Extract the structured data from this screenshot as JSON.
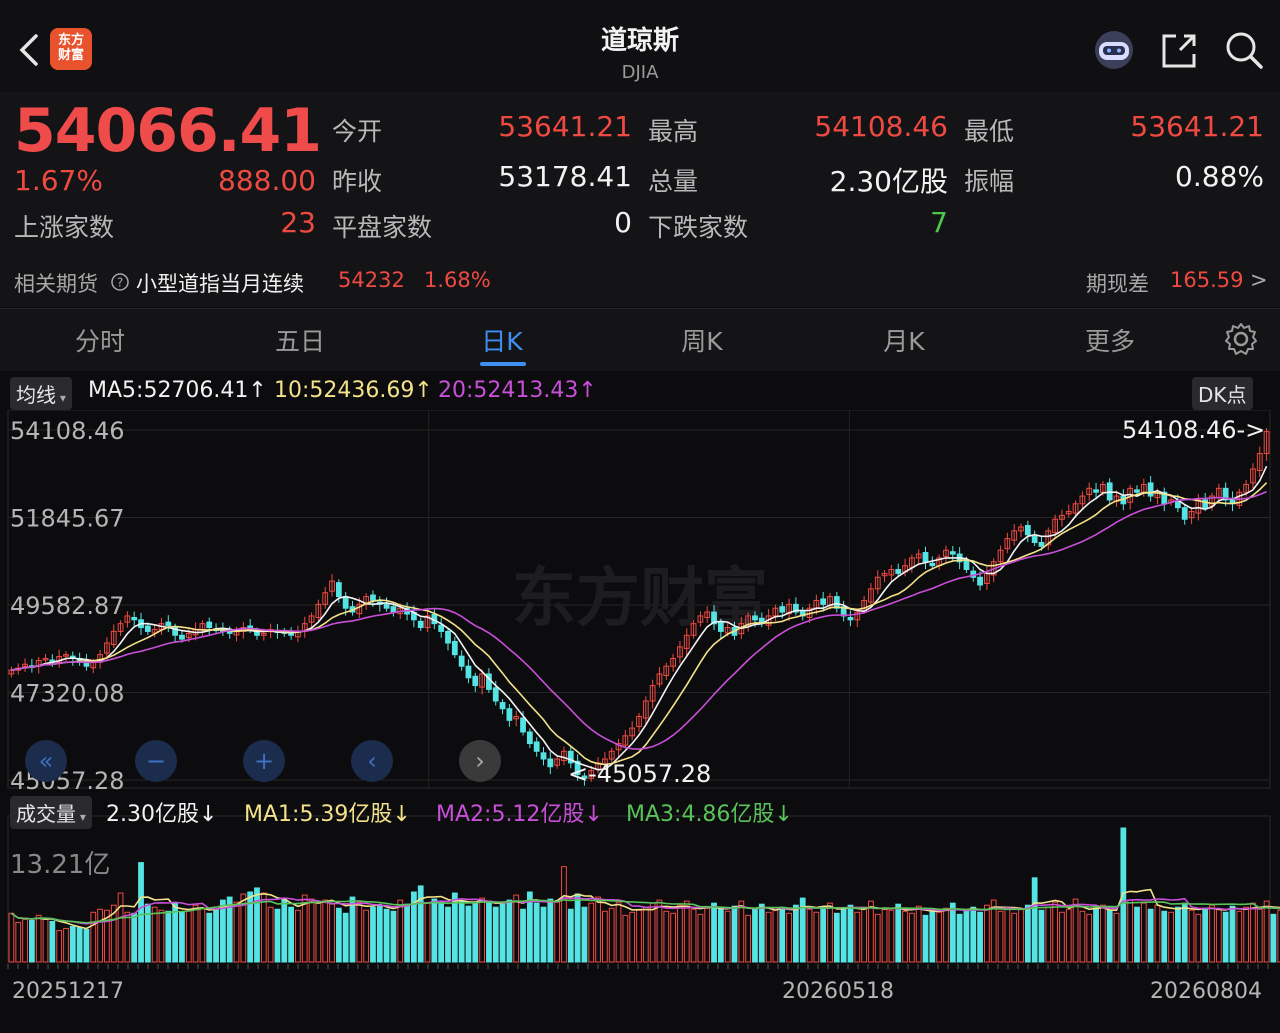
{
  "header": {
    "back_icon": "chevron-left-icon",
    "logo_text_1": "东方",
    "logo_text_2": "财富",
    "title": "道琼斯",
    "subtitle": "DJIA",
    "robot_icon": "robot-assistant-icon",
    "share_icon": "share-icon",
    "search_icon": "search-icon"
  },
  "quote": {
    "price": "54066.41",
    "change_pct": "1.67%",
    "change_abs": "888.00",
    "rows": [
      {
        "l1": "今开",
        "v1": "53641.21",
        "c1": "red",
        "l2": "最高",
        "v2": "54108.46",
        "c2": "red",
        "l3": "最低",
        "v3": "53641.21",
        "c3": "red"
      },
      {
        "l1": "昨收",
        "v1": "53178.41",
        "c1": "wht",
        "l2": "总量",
        "v2": "2.30亿股",
        "c2": "wht",
        "l3": "振幅",
        "v3": "0.88%",
        "c3": "wht"
      }
    ],
    "up_label": "上涨家数",
    "up_value": "23",
    "flat_label": "平盘家数",
    "flat_value": "0",
    "down_label": "下跌家数",
    "down_value": "7"
  },
  "futures": {
    "label": "相关期货",
    "help_icon": "help-circle-icon",
    "name": "小型道指当月连续",
    "price": "54232",
    "pct": "1.68%",
    "basis_label": "期现差",
    "basis_value": "165.59",
    "arrow": ">"
  },
  "tabs": [
    "分时",
    "五日",
    "日K",
    "周K",
    "月K",
    "更多"
  ],
  "active_tab": "日K",
  "settings_icon": "gear-icon",
  "ma": {
    "label": "均线",
    "ma5": "MA5:52706.41",
    "ma10": "10:52436.69",
    "ma20": "20:52413.43",
    "dk_label": "DK点",
    "colors": {
      "ma5": "#f2f2f2",
      "ma10": "#f3e28a",
      "ma20": "#c84fd8"
    }
  },
  "volume": {
    "label": "成交量",
    "value": "2.30亿股",
    "ma1": "MA1:5.39亿股",
    "ma2": "MA2:5.12亿股",
    "ma3": "MA3:4.86亿股",
    "axis_top": "13.21亿",
    "colors": {
      "ma1": "#f3e28a",
      "ma2": "#c84fd8",
      "ma3": "#58c35a"
    }
  },
  "watermark": "东方财富",
  "controls": [
    "«",
    "−",
    "+",
    "‹",
    "›"
  ],
  "chart_data": {
    "type": "candlestick",
    "y_ticks": [
      "54108.46",
      "51845.67",
      "49582.87",
      "47320.08",
      "45057.28"
    ],
    "ylim": [
      45057.28,
      54108.46
    ],
    "x_ticks": [
      "20251217",
      "20260518",
      "20260804"
    ],
    "annotations": {
      "high": "54108.46->",
      "low": "<-45057.28"
    },
    "colors": {
      "up": "#ef4a42",
      "down": "#55e3e3"
    },
    "close_series": [
      47900,
      47950,
      48050,
      48000,
      48150,
      48200,
      48100,
      48250,
      48300,
      48200,
      48100,
      48000,
      48100,
      48300,
      48600,
      48900,
      49100,
      49300,
      49200,
      49000,
      48900,
      48950,
      49100,
      49050,
      48800,
      48700,
      48850,
      48950,
      49100,
      49000,
      48950,
      48900,
      48850,
      48900,
      49000,
      48950,
      48800,
      48850,
      48950,
      48900,
      48850,
      48800,
      48900,
      49100,
      49300,
      49600,
      49900,
      50200,
      49800,
      49500,
      49400,
      49600,
      49800,
      49700,
      49600,
      49500,
      49400,
      49500,
      49350,
      49200,
      49000,
      49300,
      49100,
      48900,
      48600,
      48300,
      48000,
      47700,
      47500,
      47800,
      47400,
      47100,
      46900,
      46600,
      46700,
      46300,
      46000,
      45800,
      45600,
      45400,
      45600,
      45800,
      45500,
      45200,
      45100,
      45300,
      45500,
      45600,
      45800,
      46000,
      46200,
      46400,
      46700,
      47100,
      47500,
      47800,
      48000,
      48200,
      48500,
      48800,
      49100,
      49300,
      49400,
      49100,
      48900,
      49000,
      48800,
      49100,
      49300,
      49200,
      49100,
      49300,
      49500,
      49400,
      49600,
      49400,
      49300,
      49500,
      49700,
      49600,
      49800,
      49500,
      49300,
      49200,
      49400,
      49700,
      50000,
      50300,
      50400,
      50500,
      50400,
      50600,
      50800,
      50900,
      50700,
      50600,
      50800,
      51000,
      50900,
      50700,
      50500,
      50300,
      50100,
      50400,
      50700,
      51000,
      51300,
      51500,
      51600,
      51400,
      51200,
      51100,
      51500,
      51800,
      51900,
      52000,
      52200,
      52400,
      52600,
      52500,
      52700,
      52300,
      52400,
      52200,
      52600,
      52500,
      52700,
      52400,
      52500,
      52200,
      52300,
      52100,
      51800,
      52000,
      52300,
      52100,
      52400,
      52600,
      52300,
      52200,
      52500,
      52700,
      53100,
      53500,
      54066.41
    ],
    "volume_series": [
      4.8,
      3.9,
      4.2,
      4.1,
      4.6,
      4.3,
      4.0,
      3.1,
      3.3,
      3.5,
      3.4,
      3.2,
      4.9,
      5.2,
      5.1,
      5.6,
      6.8,
      4.9,
      4.8,
      9.8,
      5.7,
      5.4,
      5.1,
      5.0,
      5.8,
      4.9,
      5.1,
      5.6,
      5.3,
      4.8,
      5.2,
      6.1,
      6.4,
      5.9,
      6.7,
      6.9,
      7.3,
      6.8,
      5.4,
      5.2,
      6.3,
      5.4,
      5.1,
      6.6,
      6.2,
      5.8,
      6.1,
      5.7,
      5.3,
      4.8,
      6.4,
      5.9,
      5.1,
      5.4,
      5.6,
      5.2,
      5.0,
      6.1,
      5.7,
      6.9,
      7.5,
      5.8,
      6.2,
      5.9,
      5.4,
      6.8,
      6.0,
      5.5,
      5.8,
      6.3,
      6.0,
      5.4,
      5.7,
      6.1,
      6.6,
      5.2,
      6.9,
      5.8,
      5.4,
      6.2,
      5.9,
      9.4,
      5.2,
      6.7,
      5.4,
      5.8,
      6.4,
      5.0,
      5.3,
      5.9,
      4.6,
      4.9,
      5.1,
      5.4,
      5.8,
      6.1,
      5.0,
      4.8,
      5.6,
      6.0,
      5.2,
      4.7,
      5.3,
      5.8,
      5.4,
      5.0,
      5.5,
      6.0,
      4.6,
      5.3,
      5.7,
      4.9,
      5.1,
      5.4,
      4.8,
      5.6,
      6.3,
      5.2,
      4.9,
      5.4,
      5.8,
      4.8,
      5.3,
      5.6,
      4.9,
      5.4,
      6.0,
      4.7,
      5.2,
      5.1,
      5.7,
      5.0,
      4.8,
      5.5,
      4.6,
      5.2,
      4.9,
      5.3,
      5.8,
      4.7,
      5.1,
      5.4,
      4.9,
      5.6,
      6.1,
      5.0,
      5.3,
      4.8,
      5.2,
      5.6,
      8.3,
      5.1,
      5.4,
      5.9,
      4.9,
      5.2,
      6.2,
      5.0,
      4.7,
      5.3,
      5.6,
      5.1,
      4.8,
      13.21,
      6.1,
      5.4,
      5.8,
      5.2,
      5.6,
      5.0,
      4.9,
      5.4,
      5.8,
      5.1,
      4.7,
      5.3,
      5.6,
      5.2,
      4.9,
      5.5,
      5.0,
      5.4,
      5.8,
      5.2,
      6.0,
      4.7,
      5.1,
      5.4,
      2.3
    ]
  }
}
